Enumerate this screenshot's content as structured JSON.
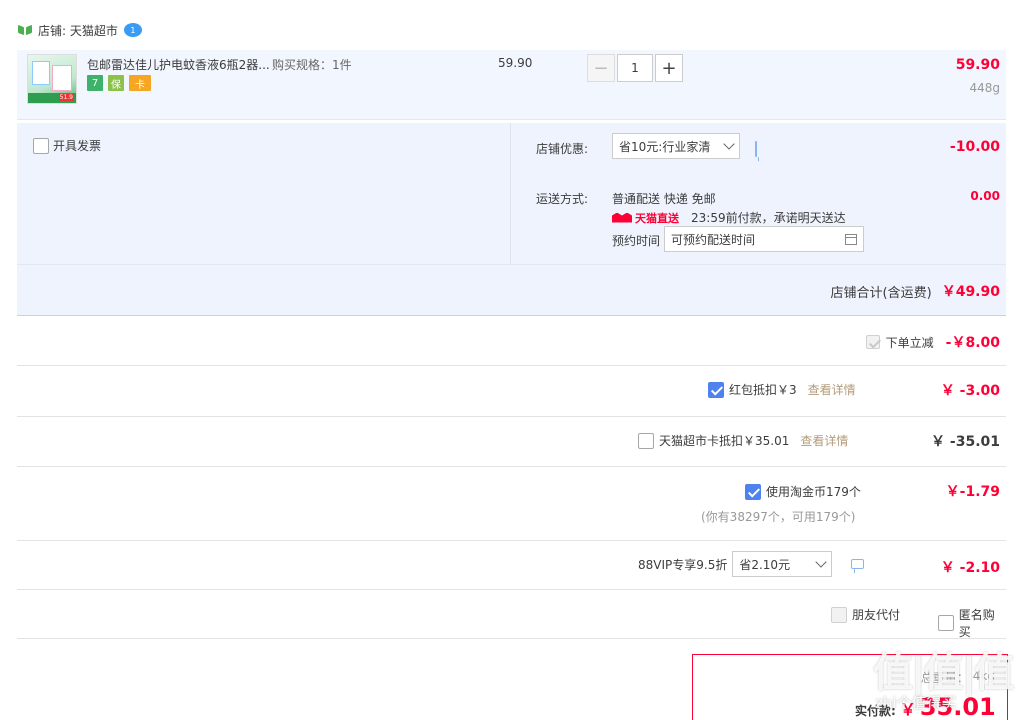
{
  "shop": {
    "label": "店铺: 天猫超市",
    "chat_badge": "1"
  },
  "item": {
    "title": "包邮雷达佳儿护电蚊香液6瓶2器...",
    "spec": "购买规格：1件",
    "unit_price": "59.90",
    "quantity": "1",
    "total": "59.90",
    "weight": "448g",
    "badges": [
      "7",
      "保",
      "卡"
    ],
    "thumb_price": "51.9"
  },
  "invoice": {
    "label": "开具发票"
  },
  "shop_discount": {
    "label": "店铺优惠:",
    "selected": "省10元:行业家清",
    "amount": "-10.00"
  },
  "shipping": {
    "label": "运送方式:",
    "method": "普通配送 快递 免邮",
    "badge": "天猫直送",
    "promise": "23:59前付款，承诺明天送达",
    "appointment_label": "预约时间",
    "appointment_value": "可预约配送时间",
    "amount": "0.00"
  },
  "shop_total": {
    "label": "店铺合计(含运费)",
    "amount": "￥49.90"
  },
  "instant_discount": {
    "label": "下单立减",
    "amount": "-￥8.00"
  },
  "red_packet": {
    "label": "红包抵扣￥3",
    "link": "查看详情",
    "amount": "￥ -3.00"
  },
  "tmall_card": {
    "label": "天猫超市卡抵扣￥35.01",
    "link": "查看详情",
    "amount": "￥ -35.01"
  },
  "taojinbi": {
    "label": "使用淘金币179个",
    "note": "(你有38297个，可用179个)",
    "amount": "￥-1.79"
  },
  "vip": {
    "label": "88VIP专享9.5折",
    "selected": "省2.10元",
    "amount": "￥ -2.10"
  },
  "friend_pay": {
    "label": "朋友代付"
  },
  "anonymous": {
    "label": "匿名购买"
  },
  "payment": {
    "weight_label": "总重量：",
    "weight_value": "4kg",
    "label": "实付款:",
    "currency": "￥",
    "amount": "35.01"
  },
  "watermark": {
    "main": "值|值|值",
    "sub": "zhi个值得买"
  },
  "colors": {
    "accent_red": "#ff0036",
    "checkbox_blue": "#4e82ee",
    "option_bg": "#eef3fd",
    "item_bg": "#f1f6ff"
  }
}
